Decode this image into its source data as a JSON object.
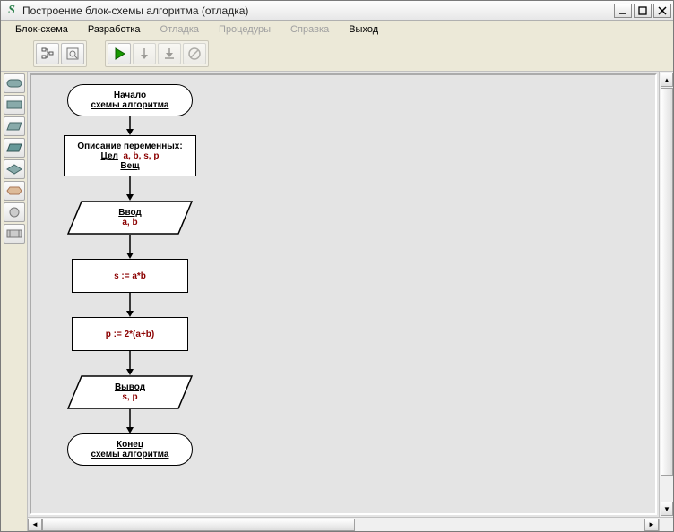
{
  "window": {
    "title": "Построение блок-схемы алгоритма (отладка)",
    "app_icon_letter": "S"
  },
  "menu": {
    "scheme": "Блок-схема",
    "dev": "Разработка",
    "debug": "Отладка",
    "proc": "Процедуры",
    "help": "Справка",
    "exit": "Выход"
  },
  "flowchart": {
    "start_line1": "Начало",
    "start_line2": "схемы алгоритма",
    "desc_title": "Описание переменных:",
    "desc_int_label": "Цел",
    "desc_int_vars": "a, b, s, p",
    "desc_real_label": "Вещ",
    "input_label": "Ввод",
    "input_vars": "a, b",
    "proc1": "s := a*b",
    "proc2": "p := 2*(a+b)",
    "output_label": "Вывод",
    "output_vars": "s, p",
    "end_line1": "Конец",
    "end_line2": "схемы алгоритма"
  }
}
